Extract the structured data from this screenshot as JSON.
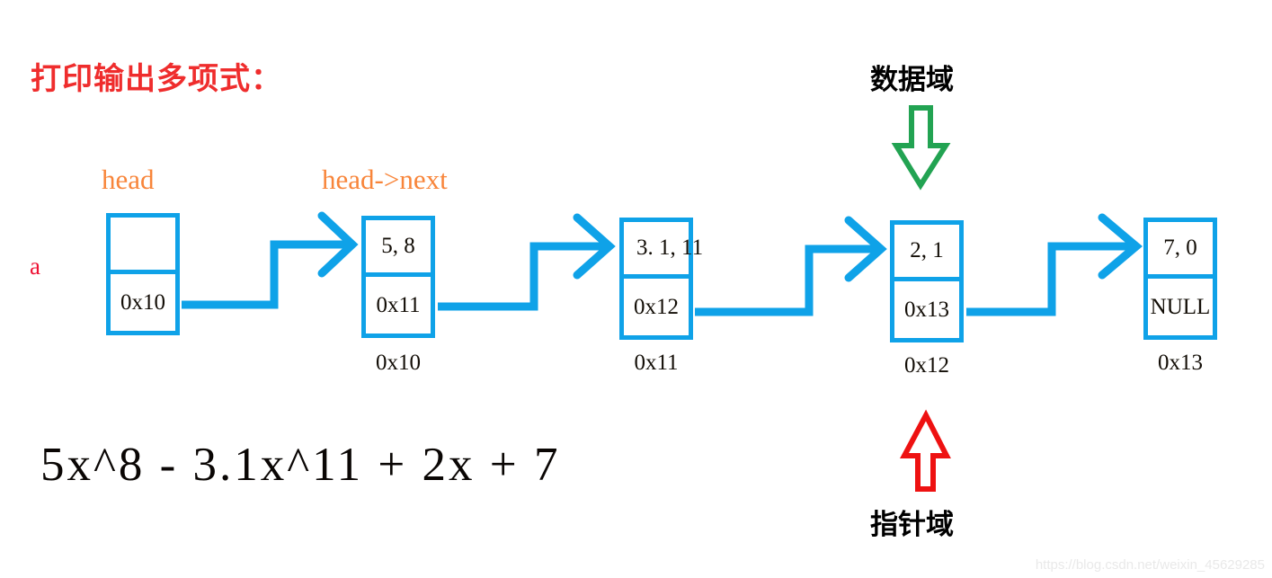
{
  "title": "打印输出多项式：",
  "variable_label": "a",
  "pointer_labels": {
    "head": "head",
    "head_next": "head->next"
  },
  "nodes": [
    {
      "data": "",
      "pointer": "0x10",
      "address": ""
    },
    {
      "data": "5, 8",
      "pointer": "0x11",
      "address": "0x10"
    },
    {
      "data": "3. 1, 11",
      "pointer": "0x12",
      "address": "0x11"
    },
    {
      "data": "2, 1",
      "pointer": "0x13",
      "address": "0x12"
    },
    {
      "data": "7, 0",
      "pointer": "NULL",
      "address": "0x13"
    }
  ],
  "annotations": {
    "data_field": "数据域",
    "pointer_field": "指针域"
  },
  "formula": "5x^8 - 3.1x^11 + 2x + 7",
  "watermark": "https://blog.csdn.net/weixin_45629285",
  "colors": {
    "title_red": "#ef2d2d",
    "pointer_orange": "#f8853a",
    "box_blue": "#0fa2e8",
    "data_arrow_green": "#22a352",
    "pointer_arrow_red": "#ee1111",
    "text_black": "#120d06",
    "var_red": "#ee1133"
  }
}
